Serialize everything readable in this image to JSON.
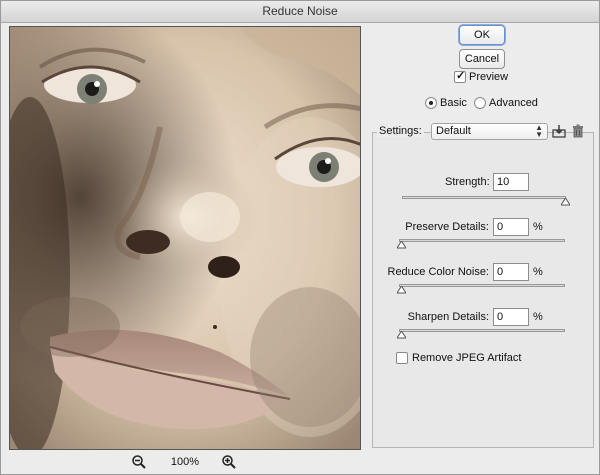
{
  "window": {
    "title": "Reduce Noise"
  },
  "preview": {
    "zoom_out_icon": "zoom-out-icon",
    "zoom_in_icon": "zoom-in-icon",
    "zoom_level": "100%"
  },
  "buttons": {
    "ok": "OK",
    "cancel": "Cancel"
  },
  "preview_toggle": {
    "label": "Preview",
    "checked": true
  },
  "mode": {
    "basic": "Basic",
    "advanced": "Advanced",
    "selected": "Basic"
  },
  "settings": {
    "label": "Settings:",
    "value": "Default",
    "save_icon": "save-preset-icon",
    "delete_icon": "trash-icon"
  },
  "controls": {
    "strength": {
      "label": "Strength:",
      "value": "10",
      "level": 1.0
    },
    "preserve_details": {
      "label": "Preserve Details:",
      "value": "0",
      "unit": "%",
      "level": 0.0
    },
    "reduce_color_noise": {
      "label": "Reduce Color Noise:",
      "value": "0",
      "unit": "%",
      "level": 0.0
    },
    "sharpen_details": {
      "label": "Sharpen Details:",
      "value": "0",
      "unit": "%",
      "level": 0.0
    }
  },
  "jpeg": {
    "label": "Remove JPEG Artifact",
    "checked": false
  },
  "colors": {
    "focus_ring": "#6a8fcf",
    "dialog_bg": "#ececec"
  }
}
